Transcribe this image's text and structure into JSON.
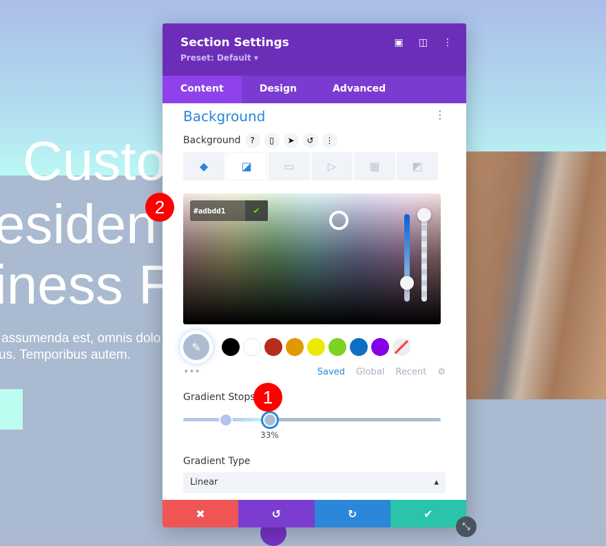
{
  "hero": {
    "headline_lines": [
      "Custo",
      "esiden",
      "iness Fl"
    ],
    "paragraph_lines": [
      "assumenda est, omnis dolo",
      "us. Temporibus autem."
    ]
  },
  "badges": [
    "1",
    "2"
  ],
  "modal": {
    "title": "Section Settings",
    "preset": "Preset: Default ▾",
    "header_icons": [
      "focus-icon",
      "split-view-icon",
      "more-icon"
    ],
    "tabs": [
      {
        "label": "Content",
        "active": true
      },
      {
        "label": "Design"
      },
      {
        "label": "Advanced"
      }
    ],
    "section_title": "Background",
    "field_label": "Background",
    "bg_tabs": [
      "color",
      "gradient",
      "image",
      "video",
      "pattern",
      "mask"
    ],
    "active_bg_tab": "gradient",
    "picker": {
      "hex": "#adbdd1"
    },
    "swatches": [
      "#000000",
      "#ffffff",
      "#b72c1e",
      "#e09900",
      "#eaeb00",
      "#7cd321",
      "#0c71c3",
      "#8300e9",
      "transparent"
    ],
    "palette_tabs": [
      "Saved",
      "Global",
      "Recent"
    ],
    "active_palette_tab": "Saved",
    "gradient_stops_label": "Gradient Stops",
    "stops": [
      {
        "color": "#b4c4ec",
        "position": 17
      },
      {
        "color": "#adbdd1",
        "position": 33,
        "active": true
      }
    ],
    "stop_value": "33%",
    "gradient_type_label": "Gradient Type",
    "gradient_type": "Linear"
  },
  "colors": {
    "header": "#6c2eb9",
    "tabs": "#7c3bd0",
    "accent": "#2b87da",
    "cancel": "#ef5555",
    "undo": "#7b3cd0",
    "redo": "#2b87da",
    "save": "#29c4a9"
  }
}
